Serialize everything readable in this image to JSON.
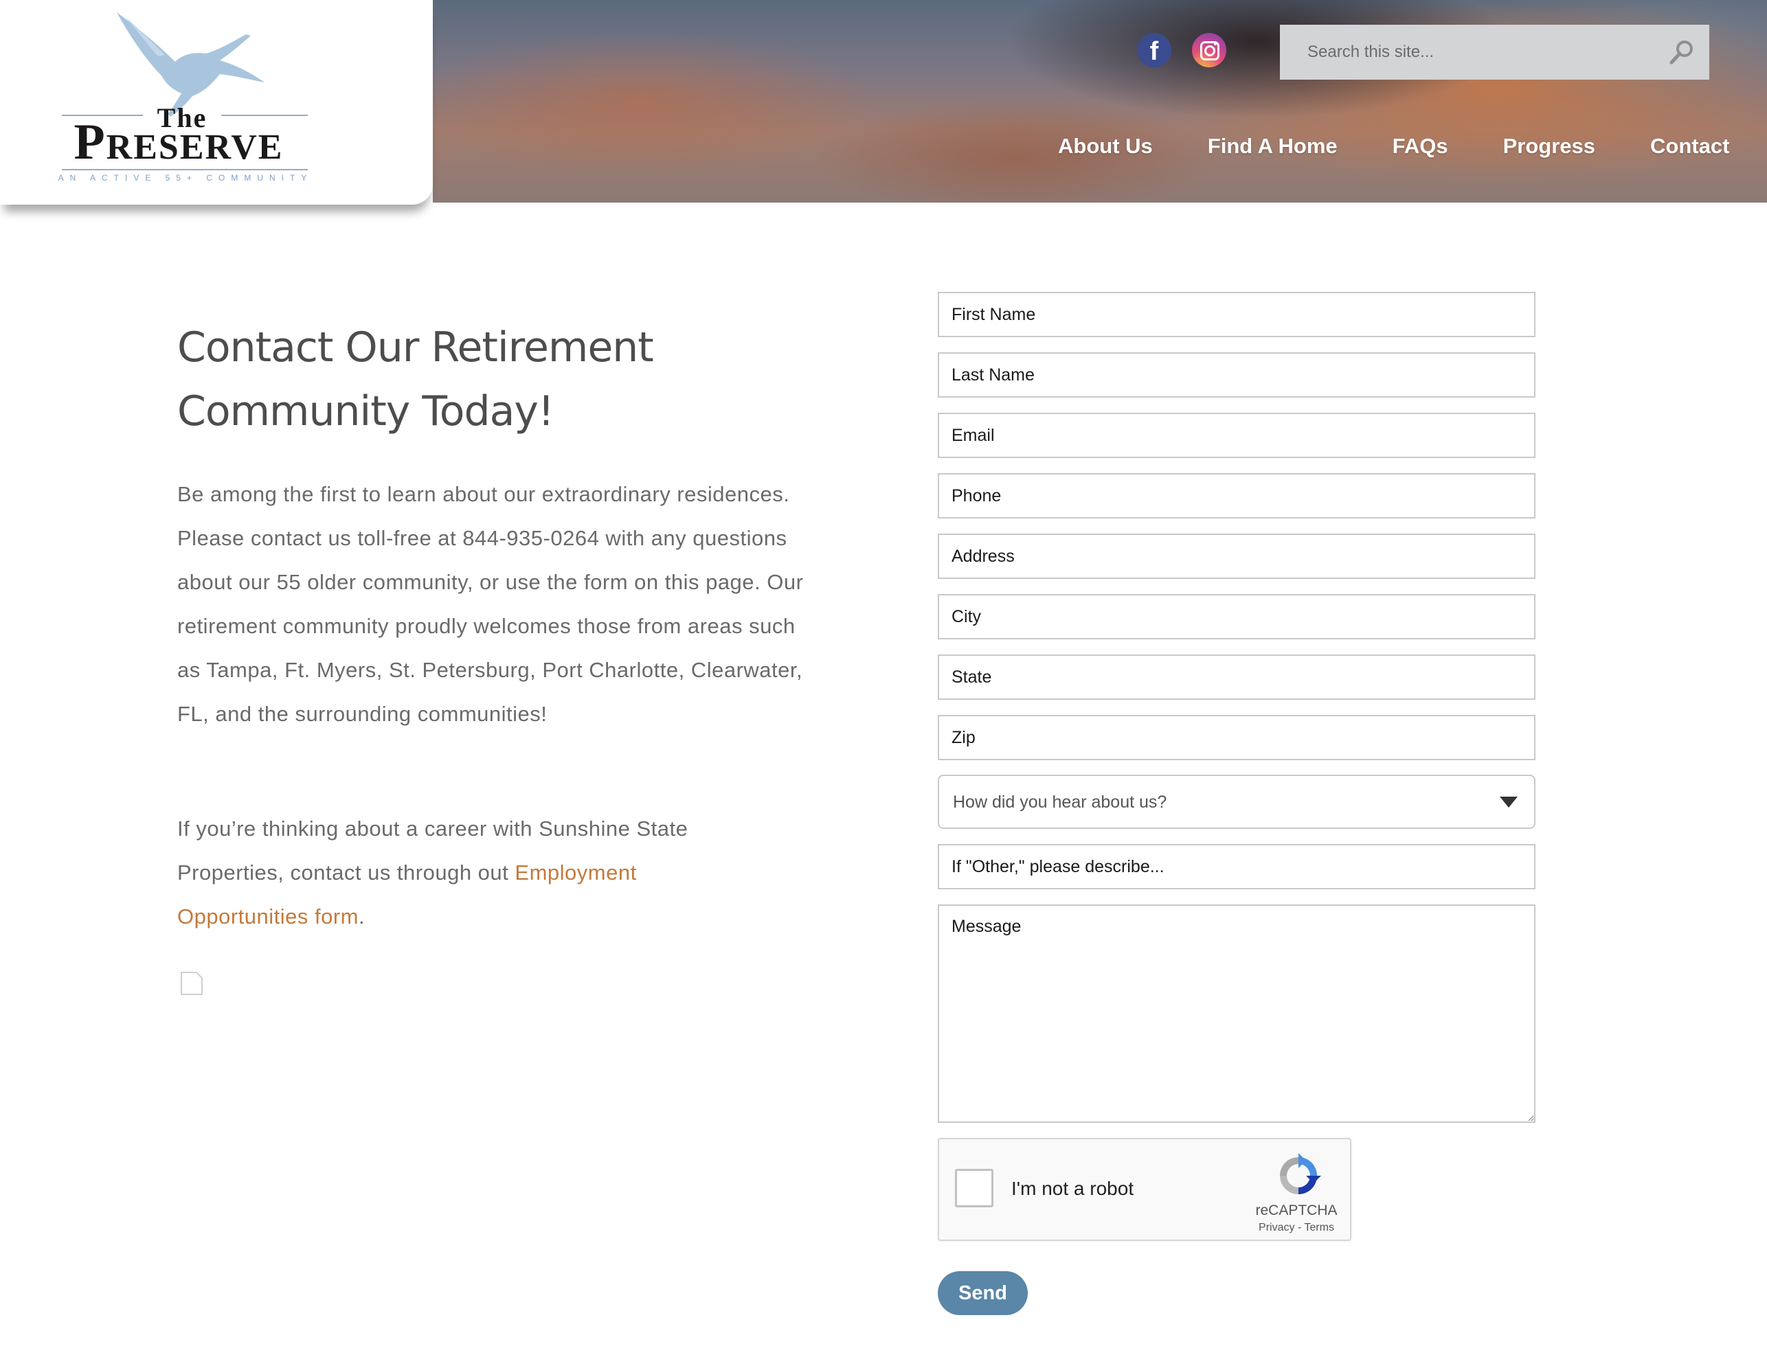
{
  "logo": {
    "the": "The",
    "preserve": "Preserve",
    "tagline": "AN ACTIVE 55+ COMMUNITY"
  },
  "header": {
    "social": {
      "facebook_glyph": "f"
    },
    "search": {
      "placeholder": "Search this site..."
    },
    "nav": [
      "About Us",
      "Find A Home",
      "FAQs",
      "Progress",
      "Contact"
    ]
  },
  "main": {
    "title": "Contact Our Retirement Community Today!",
    "intro": "Be among the first to learn about our extraordinary residences. Please contact us toll-free at 844-935-0264 with any questions about our 55 older community, or use the form on this page. Our retirement community proudly welcomes those from areas such as Tampa, Ft. Myers, St. Petersburg, Port Charlotte, Clearwater, FL, and the surrounding communities!",
    "career_text": "If you’re thinking about a career with Sunshine State Properties, contact us through out ",
    "career_link": "Employment Opportunities form",
    "career_end": "."
  },
  "form": {
    "first_name": "First Name",
    "last_name": "Last Name",
    "email": "Email",
    "phone": "Phone",
    "address": "Address",
    "city": "City",
    "state": "State",
    "zip": "Zip",
    "hear_about": "How did you hear about us?",
    "other_describe": "If \"Other,\" please describe...",
    "message": "Message",
    "captcha": {
      "label": "I'm not a robot",
      "brand": "reCAPTCHA",
      "privacy": "Privacy",
      "separator": " - ",
      "terms": "Terms"
    },
    "send": "Send"
  },
  "colors": {
    "accent_link": "#c47a3a",
    "button": "#5a86a7",
    "logo_blue": "#8aaed0"
  },
  "icons": [
    "crane-bird-logo",
    "facebook-icon",
    "instagram-icon",
    "search-icon",
    "document-icon",
    "recaptcha-icon",
    "dropdown-caret-icon"
  ]
}
